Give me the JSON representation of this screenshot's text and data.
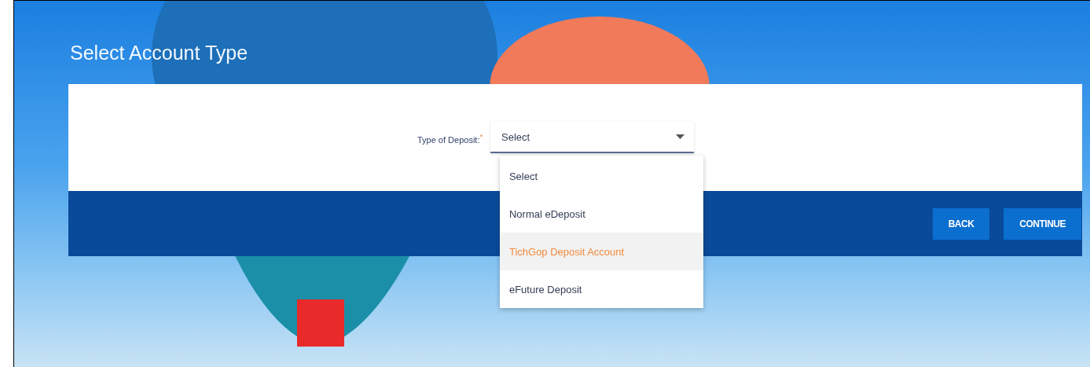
{
  "page": {
    "title": "Select Account Type"
  },
  "form": {
    "label": "Type of Deposit:",
    "required_mark": "*",
    "value": "Select",
    "expanded": true,
    "options": [
      {
        "label": "Select",
        "highlighted": false
      },
      {
        "label": "Normal eDeposit",
        "highlighted": false
      },
      {
        "label": "TichGop Deposit Account",
        "highlighted": true
      },
      {
        "label": "eFuture Deposit",
        "highlighted": false
      }
    ]
  },
  "buttons": [
    "BACK",
    "CONTINUE"
  ]
}
